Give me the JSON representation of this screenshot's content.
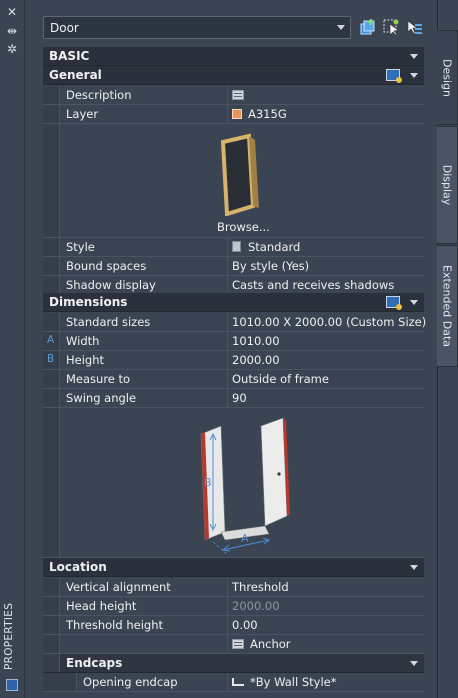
{
  "palette": {
    "title": "PROPERTIES"
  },
  "selector": {
    "value": "Door"
  },
  "toolbar": {
    "icons": [
      "add-selection-icon",
      "quick-select-icon",
      "select-objects-icon"
    ]
  },
  "tabs": [
    "Design",
    "Display",
    "Extended Data"
  ],
  "basic": {
    "label": "BASIC"
  },
  "general": {
    "label": "General",
    "description_label": "Description",
    "layer_label": "Layer",
    "layer_value": "A315G",
    "layer_color": "#e8965a",
    "browse_label": "Browse...",
    "style_label": "Style",
    "style_value": "Standard",
    "bound_label": "Bound spaces",
    "bound_value": "By style (Yes)",
    "shadow_label": "Shadow display",
    "shadow_value": "Casts and receives shadows"
  },
  "dimensions": {
    "label": "Dimensions",
    "standard_label": "Standard sizes",
    "standard_value": "1010.00  X  2000.00 (Custom Size)",
    "width_letter": "A",
    "width_label": "Width",
    "width_value": "1010.00",
    "height_letter": "B",
    "height_label": "Height",
    "height_value": "2000.00",
    "measure_label": "Measure to",
    "measure_value": "Outside of frame",
    "swing_label": "Swing angle",
    "swing_value": "90",
    "diagram_a": "A",
    "diagram_b": "B"
  },
  "location": {
    "label": "Location",
    "valign_label": "Vertical alignment",
    "valign_value": "Threshold",
    "head_label": "Head height",
    "head_value": "2000.00",
    "threshold_label": "Threshold height",
    "threshold_value": "0.00",
    "anchor_value": "Anchor"
  },
  "endcaps": {
    "label": "Endcaps",
    "opening_label": "Opening endcap",
    "opening_value": "*By Wall Style*"
  }
}
